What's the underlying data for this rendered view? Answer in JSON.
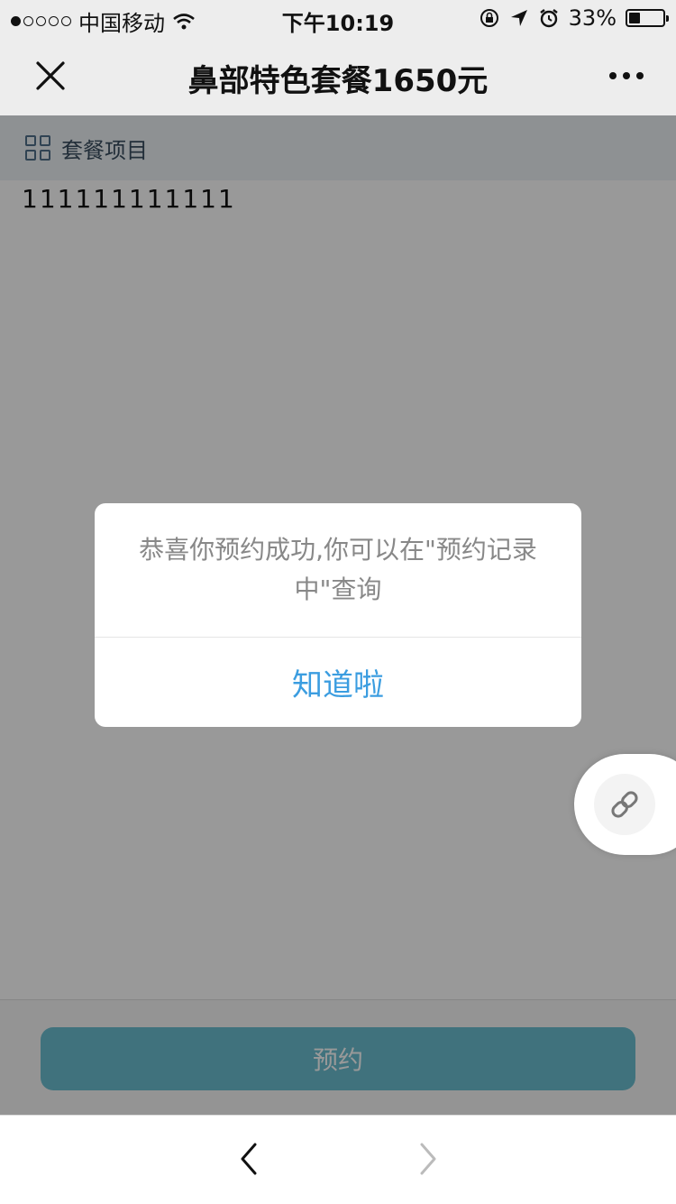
{
  "status_bar": {
    "carrier": "中国移动",
    "time": "下午10:19",
    "battery": "33%"
  },
  "nav": {
    "title": "鼻部特色套餐1650元"
  },
  "section": {
    "label": "套餐项目",
    "content": "111111111111"
  },
  "bottom": {
    "book_label": "预约"
  },
  "dialog": {
    "message": "恭喜你预约成功,你可以在\"预约记录中\"查询",
    "ok_label": "知道啦"
  },
  "colors": {
    "accent": "#3b9de0",
    "book_button": "#6cbfd0",
    "section_bg": "#edf2f5"
  }
}
